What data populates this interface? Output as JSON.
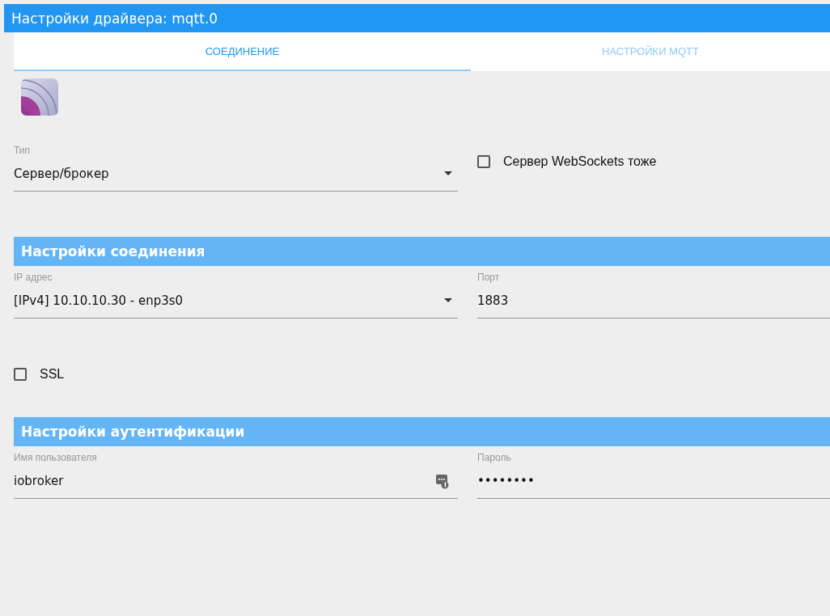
{
  "window": {
    "title": "Настройки драйвера: mqtt.0"
  },
  "tabs": [
    {
      "label": "СОЕДИНЕНИЕ",
      "selected": true
    },
    {
      "label": "НАСТРОЙКИ MQTT",
      "selected": false
    }
  ],
  "top_row": {
    "type_field": {
      "kind": "select",
      "label": "Тип",
      "value": "Сервер/брокер"
    },
    "websockets": {
      "label": "Сервер WebSockets тоже",
      "checked": false
    }
  },
  "connection": {
    "title": "Настройки соединения",
    "fields": [
      {
        "kind": "select",
        "label": "IP адрес",
        "value": "[IPv4] 10.10.10.30 - enp3s0"
      },
      {
        "kind": "text",
        "label": "Порт",
        "value": "1883"
      }
    ],
    "ssl": {
      "label": "SSL",
      "checked": false
    }
  },
  "authentication": {
    "title": "Настройки аутентификации",
    "fields": [
      {
        "kind": "autofill",
        "label": "Имя пользователя",
        "value": "iobroker"
      },
      {
        "kind": "text",
        "label": "Пароль",
        "value": "••••••••"
      }
    ]
  }
}
